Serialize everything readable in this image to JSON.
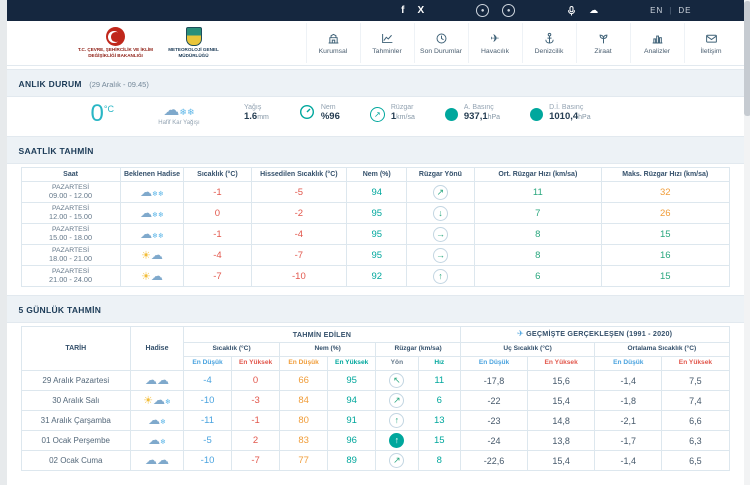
{
  "topbar": {
    "lang_en": "EN",
    "lang_de": "DE",
    "divider": "|"
  },
  "icons": {
    "facebook": "f",
    "twitter_x": "X",
    "cloud": "☁",
    "sun": "☀",
    "snowflake": "❄",
    "plane": "✈"
  },
  "header": {
    "ministry_name": "T.C. ÇEVRE, ŞEHİRCİLİK VE İKLİM DEĞİŞİKLİĞİ BAKANLIĞI",
    "mgm_name": "METEOROLOJİ GENEL MÜDÜRLÜĞÜ"
  },
  "nav": {
    "items": [
      {
        "label": "Kurumsal"
      },
      {
        "label": "Tahminler"
      },
      {
        "label": "Son Durumlar"
      },
      {
        "label": "Havacılık"
      },
      {
        "label": "Denizcilik"
      },
      {
        "label": "Ziraat"
      },
      {
        "label": "Analizler"
      },
      {
        "label": "İletişim"
      }
    ]
  },
  "current": {
    "section_title": "ANLIK DURUM",
    "section_sub": "(29 Aralık - 09.45)",
    "temp": "0",
    "temp_unit": "°C",
    "condition": "Hafif Kar Yağışı",
    "cond_icon": {
      "sun": "",
      "cloud": "☁",
      "snow": "❄❄"
    },
    "yagis_label": "Yağış",
    "yagis_value": "1.6",
    "yagis_unit": "mm",
    "nem_label": "Nem",
    "nem_value": "%96",
    "ruzgar_label": "Rüzgar",
    "ruzgar_value": "1",
    "ruzgar_unit": "km/sa",
    "ruzgar_dir": "↗",
    "abasinc_label": "A. Basınç",
    "abasinc_value": "937,1",
    "abasinc_unit": "hPa",
    "dibasinc_label": "D.İ. Basınç",
    "dibasinc_value": "1010,4",
    "dibasinc_unit": "hPa"
  },
  "hourly": {
    "section_title": "SAATLİK TAHMİN",
    "headers": [
      "Saat",
      "Beklenen Hadise",
      "Sıcaklık (°C)",
      "Hissedilen Sıcaklık (°C)",
      "Nem (%)",
      "Rüzgar Yönü",
      "Ort. Rüzgar Hızı (km/sa)",
      "Maks. Rüzgar Hızı (km/sa)"
    ],
    "rows": [
      {
        "day": "PAZARTESİ",
        "time": "09.00 - 12.00",
        "icon_sun": "",
        "icon_cloud": "☁",
        "icon_snow": "❄❄",
        "temp": "-1",
        "feels": "-5",
        "nem": "94",
        "dir": "↗",
        "ort": "11",
        "maks": "32"
      },
      {
        "day": "PAZARTESİ",
        "time": "12.00 - 15.00",
        "icon_sun": "",
        "icon_cloud": "☁",
        "icon_snow": "❄❄",
        "temp": "0",
        "feels": "-2",
        "nem": "95",
        "dir": "↓",
        "ort": "7",
        "maks": "26"
      },
      {
        "day": "PAZARTESİ",
        "time": "15.00 - 18.00",
        "icon_sun": "",
        "icon_cloud": "☁",
        "icon_snow": "❄❄",
        "temp": "-1",
        "feels": "-4",
        "nem": "95",
        "dir": "→",
        "ort": "8",
        "maks": "15"
      },
      {
        "day": "PAZARTESİ",
        "time": "18.00 - 21.00",
        "icon_sun": "☀",
        "icon_cloud": "☁",
        "icon_snow": "",
        "temp": "-4",
        "feels": "-7",
        "nem": "95",
        "dir": "→",
        "ort": "8",
        "maks": "16"
      },
      {
        "day": "PAZARTESİ",
        "time": "21.00 - 24.00",
        "icon_sun": "☀",
        "icon_cloud": "☁",
        "icon_snow": "",
        "temp": "-7",
        "feels": "-10",
        "nem": "92",
        "dir": "↑",
        "ort": "6",
        "maks": "15"
      }
    ]
  },
  "daily": {
    "section_title": "5 GÜNLÜK TAHMİN",
    "col_tarih": "TARİH",
    "col_hadise": "Hadise",
    "group_forecast": "TAHMİN EDİLEN",
    "group_past": "GEÇMİŞTE GERÇEKLEŞEN (1991 - 2020)",
    "sub_sicaklik": "Sıcaklık (°C)",
    "sub_nem": "Nem (%)",
    "sub_ruzgar": "Rüzgar (km/sa)",
    "sub_uc": "Uç Sıcaklık (°C)",
    "sub_ortalama": "Ortalama Sıcaklık (°C)",
    "lbl_low": "En Düşük",
    "lbl_high": "En Yüksek",
    "lbl_yon": "Yön",
    "lbl_hiz": "Hız",
    "rows": [
      {
        "date": "29 Aralık Pazartesi",
        "icon_sun": "",
        "icon_cloud": "☁☁",
        "icon_snow": "",
        "tmin": "-4",
        "tmax": "0",
        "nmin": "66",
        "nmax": "95",
        "dir": "↖",
        "hiz": "11",
        "ucmin": "-17,8",
        "ucmax": "15,6",
        "omin": "-1,4",
        "omax": "7,5"
      },
      {
        "date": "30 Aralık Salı",
        "icon_sun": "☀",
        "icon_cloud": "☁",
        "icon_snow": "❄",
        "tmin": "-10",
        "tmax": "-3",
        "nmin": "84",
        "nmax": "94",
        "dir": "↗",
        "hiz": "6",
        "ucmin": "-22",
        "ucmax": "15,4",
        "omin": "-1,8",
        "omax": "7,4"
      },
      {
        "date": "31 Aralık Çarşamba",
        "icon_sun": "",
        "icon_cloud": "☁",
        "icon_snow": "❄",
        "tmin": "-11",
        "tmax": "-1",
        "nmin": "80",
        "nmax": "91",
        "dir": "↑",
        "hiz": "13",
        "ucmin": "-23",
        "ucmax": "14,8",
        "omin": "-2,1",
        "omax": "6,6"
      },
      {
        "date": "01 Ocak Perşembe",
        "icon_sun": "",
        "icon_cloud": "☁",
        "icon_snow": "❄",
        "tmin": "-5",
        "tmax": "2",
        "nmin": "83",
        "nmax": "96",
        "dir": "↑",
        "hiz": "15",
        "ucmin": "-24",
        "ucmax": "13,8",
        "omin": "-1,7",
        "omax": "6,3"
      },
      {
        "date": "02 Ocak Cuma",
        "icon_sun": "",
        "icon_cloud": "☁☁",
        "icon_snow": "",
        "tmin": "-10",
        "tmax": "-7",
        "nmin": "77",
        "nmax": "89",
        "dir": "↗",
        "hiz": "8",
        "ucmin": "-22,6",
        "ucmax": "15,4",
        "omin": "-1,4",
        "omax": "6,5"
      }
    ]
  },
  "colors": {
    "teal": "#00a79d",
    "cyan": "#29b6c5",
    "red": "#e2574c",
    "blue": "#4aa3df",
    "orange": "#f09d3a",
    "navy": "#15273f"
  }
}
